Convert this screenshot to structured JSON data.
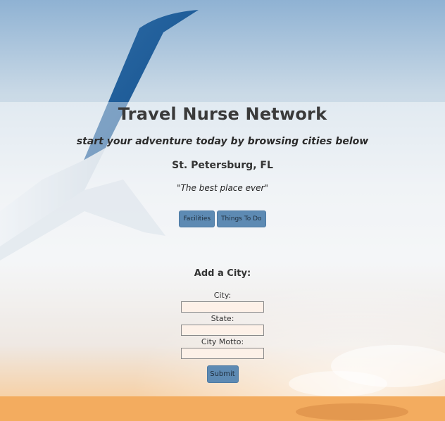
{
  "header": {
    "title": "Travel Nurse Network",
    "tagline": "start your adventure today by browsing cities below"
  },
  "city": {
    "name": "St. Petersburg, FL",
    "motto": "\"The best place ever\"",
    "buttons": [
      "Facilities",
      "Things To Do"
    ]
  },
  "add_city": {
    "heading": "Add a City:",
    "fields": [
      {
        "label": "City:",
        "value": ""
      },
      {
        "label": "State:",
        "value": ""
      },
      {
        "label": "City Motto:",
        "value": ""
      }
    ],
    "submit_label": "Submit"
  },
  "colors": {
    "button": "#5d8ab3",
    "input_bg": "#fdf1e8",
    "sky_top": "#8fb2d3",
    "sunset": "#f2a85c"
  }
}
